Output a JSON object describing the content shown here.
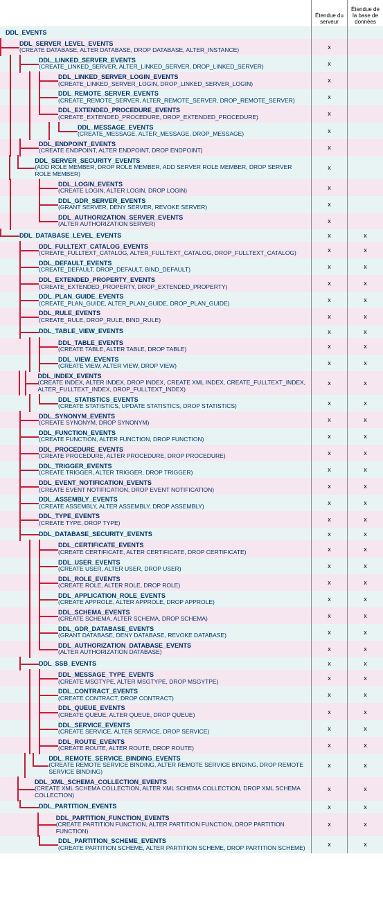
{
  "headers": {
    "col1": "Étendue du serveur",
    "col2": "Étendue de la base de données"
  },
  "tree": [
    {
      "depth": 0,
      "last": true,
      "name": "DDL_EVENTS",
      "desc": "",
      "s": "",
      "d": "",
      "bg": "even"
    },
    {
      "depth": 1,
      "last": false,
      "name": "DDL_SERVER_LEVEL_EVENTS",
      "desc": "(CREATE DATABASE, ALTER DATABASE, DROP DATABASE, ALTER_INSTANCE)",
      "s": "x",
      "d": "",
      "bg": "odd",
      "contLines": [
        true
      ]
    },
    {
      "depth": 2,
      "last": false,
      "name": "DDL_LINKED_SERVER_EVENTS",
      "desc": "(CREATE_LINKED_SERVER, ALTER_LINKED_SERVER, DROP_LINKED_SERVER)",
      "s": "x",
      "d": "",
      "bg": "even",
      "contLines": [
        true,
        true
      ]
    },
    {
      "depth": 3,
      "last": false,
      "name": "DDL_LINKED_SERVER_LOGIN_EVENTS",
      "desc": "(CREATE_LINKED_SERVER_LOGIN, DROP_LINKED_SERVER_LOGIN)",
      "s": "x",
      "d": "",
      "bg": "odd",
      "contLines": [
        true,
        true,
        true
      ]
    },
    {
      "depth": 3,
      "last": false,
      "name": "DDL_REMOTE_SERVER_EVENTS",
      "desc": "(CREATE_REMOTE_SERVER, ALTER_REMOTE_SERVER, DROP_REMOTE_SERVER)",
      "s": "x",
      "d": "",
      "bg": "even",
      "contLines": [
        true,
        true,
        true
      ]
    },
    {
      "depth": 3,
      "last": true,
      "name": "DDL_EXTENDED_PROCEDURE_EVENTS",
      "desc": "(CREATE_EXTENDED_PROCEDURE, DROP_EXTENDED_PROCEDURE)",
      "s": "x",
      "d": "",
      "bg": "odd",
      "contLines": [
        true,
        true,
        true
      ]
    },
    {
      "depth": 4,
      "last": true,
      "name": "DDL_MESSAGE_EVENTS",
      "desc": "(CREATE_MESSAGE, ALTER_MESSAGE, DROP_MESSAGE)",
      "s": "x",
      "d": "",
      "bg": "even",
      "contLines": [
        true,
        true,
        true,
        false
      ]
    },
    {
      "depth": 2,
      "last": false,
      "name": "DDL_ENDPOINT_EVENTS",
      "desc": "(CREATE ENDPOINT, ALTER ENDPOINT, DROP ENDPOINT)",
      "s": "x",
      "d": "",
      "bg": "odd",
      "contLines": [
        true,
        true
      ]
    },
    {
      "depth": 2,
      "last": true,
      "name": "DDL_SERVER_SECURITY_EVENTS",
      "desc": " (ADD ROLE MEMBER, DROP ROLE MEMBER, ADD SERVER ROLE MEMBER, DROP SERVER ROLE MEMBER)",
      "s": "x",
      "d": "",
      "bg": "even",
      "contLines": [
        true,
        true
      ]
    },
    {
      "depth": 3,
      "last": false,
      "name": "DDL_LOGIN_EVENTS",
      "desc": "(CREATE LOGIN, ALTER LOGIN, DROP LOGIN)",
      "s": "x",
      "d": "",
      "bg": "odd",
      "contLines": [
        true,
        false,
        true
      ]
    },
    {
      "depth": 3,
      "last": false,
      "name": "DDL_GDR_SERVER_EVENTS",
      "desc": "(GRANT SERVER, DENY SERVER, REVOKE SERVER)",
      "s": "x",
      "d": "",
      "bg": "even",
      "contLines": [
        true,
        false,
        true
      ]
    },
    {
      "depth": 3,
      "last": true,
      "name": "DDL_AUTHORIZATION_SERVER_EVENTS",
      "desc": "(ALTER AUTHORIZATION SERVER)",
      "s": "x",
      "d": "",
      "bg": "odd",
      "contLines": [
        true,
        false,
        true
      ]
    },
    {
      "depth": 1,
      "last": true,
      "name": "DDL_DATABASE_LEVEL_EVENTS",
      "desc": "",
      "s": "x",
      "d": "x",
      "bg": "even",
      "contLines": [
        true
      ]
    },
    {
      "depth": 2,
      "last": false,
      "name": "DDL_FULLTEXT_CATALOG_EVENTS",
      "desc": "(CREATE_FULLTEXT_CATALOG, ALTER_FULLTEXT_CATALOG, DROP_FULLTEXT_CATALOG)",
      "s": "x",
      "d": "x",
      "bg": "odd",
      "contLines": [
        false,
        true
      ]
    },
    {
      "depth": 2,
      "last": false,
      "name": "DDL_DEFAULT_EVENTS",
      "desc": "(CREATE_DEFAULT, DROP_DEFAULT, BIND_DEFAULT)",
      "s": "x",
      "d": "x",
      "bg": "even",
      "contLines": [
        false,
        true
      ]
    },
    {
      "depth": 2,
      "last": false,
      "name": "DDL_EXTENDED_PROPERTY_EVENTS",
      "desc": "(CREATE_EXTENDED_PROPERTY, DROP_EXTENDED_PROPERTY)",
      "s": "x",
      "d": "x",
      "bg": "odd",
      "contLines": [
        false,
        true
      ]
    },
    {
      "depth": 2,
      "last": false,
      "name": "DDL_PLAN_GUIDE_EVENTS",
      "desc": "(CREATE_PLAN_GUIDE, ALTER_PLAN_GUIDE, DROP_PLAN_GUIDE)",
      "s": "x",
      "d": "x",
      "bg": "even",
      "contLines": [
        false,
        true
      ]
    },
    {
      "depth": 2,
      "last": false,
      "name": "DDL_RULE_EVENTS",
      "desc": "(CREATE_RULE, DROP_RULE, BIND_RULE)",
      "s": "x",
      "d": "x",
      "bg": "odd",
      "contLines": [
        false,
        true
      ]
    },
    {
      "depth": 2,
      "last": false,
      "name": "DDL_TABLE_VIEW_EVENTS",
      "desc": "",
      "s": "x",
      "d": "x",
      "bg": "even",
      "contLines": [
        false,
        true
      ]
    },
    {
      "depth": 3,
      "last": false,
      "name": "DDL_TABLE_EVENTS",
      "desc": "(CREATE TABLE, ALTER TABLE, DROP TABLE)",
      "s": "x",
      "d": "x",
      "bg": "odd",
      "contLines": [
        false,
        true,
        true
      ]
    },
    {
      "depth": 3,
      "last": false,
      "name": "DDL_VIEW_EVENTS",
      "desc": "(CREATE VIEW, ALTER VIEW, DROP VIEW)",
      "s": "x",
      "d": "x",
      "bg": "even",
      "contLines": [
        false,
        true,
        true
      ]
    },
    {
      "depth": 3,
      "last": false,
      "name": "DDL_INDEX_EVENTS",
      "desc": "(CREATE INDEX, ALTER INDEX, DROP INDEX, CREATE XML INDEX, CREATE_FULLTEXT_INDEX, ALTER_FULLTEXT_INDEX, DROP_FULLTEXT_INDEX)",
      "s": "x",
      "d": "x",
      "bg": "odd",
      "contLines": [
        false,
        true,
        true
      ]
    },
    {
      "depth": 3,
      "last": true,
      "name": "DDL_STATISTICS_EVENTS",
      "desc": "(CREATE STATISTICS, UPDATE STATISTICS, DROP STATISTICS)",
      "s": "x",
      "d": "x",
      "bg": "even",
      "contLines": [
        false,
        true,
        true
      ]
    },
    {
      "depth": 2,
      "last": false,
      "name": "DDL_SYNONYM_EVENTS",
      "desc": "(CREATE SYNONYM, DROP SYNONYM)",
      "s": "x",
      "d": "x",
      "bg": "odd",
      "contLines": [
        false,
        true
      ]
    },
    {
      "depth": 2,
      "last": false,
      "name": "DDL_FUNCTION_EVENTS",
      "desc": "(CREATE FUNCTION, ALTER FUNCTION, DROP FUNCTION)",
      "s": "x",
      "d": "x",
      "bg": "even",
      "contLines": [
        false,
        true
      ]
    },
    {
      "depth": 2,
      "last": false,
      "name": "DDL_PROCEDURE_EVENTS",
      "desc": "(CREATE PROCEDURE, ALTER PROCEDURE, DROP PROCEDURE)",
      "s": "x",
      "d": "x",
      "bg": "odd",
      "contLines": [
        false,
        true
      ]
    },
    {
      "depth": 2,
      "last": false,
      "name": "DDL_TRIGGER_EVENTS",
      "desc": "(CREATE TRIGGER, ALTER TRIGGER, DROP TRIGGER)",
      "s": "x",
      "d": "x",
      "bg": "even",
      "contLines": [
        false,
        true
      ]
    },
    {
      "depth": 2,
      "last": false,
      "name": "DDL_EVENT_NOTIFICATION_EVENTS",
      "desc": "(CREATE EVENT NOTIFICATION, DROP EVENT NOTIFICATION)",
      "s": "x",
      "d": "x",
      "bg": "odd",
      "contLines": [
        false,
        true
      ]
    },
    {
      "depth": 2,
      "last": false,
      "name": "DDL_ASSEMBLY_EVENTS",
      "desc": "(CREATE ASSEMBLY, ALTER ASSEMBLY, DROP ASSEMBLY)",
      "s": "x",
      "d": "x",
      "bg": "even",
      "contLines": [
        false,
        true
      ]
    },
    {
      "depth": 2,
      "last": false,
      "name": "DDL_TYPE_EVENTS",
      "desc": "(CREATE TYPE, DROP TYPE)",
      "s": "x",
      "d": "x",
      "bg": "odd",
      "contLines": [
        false,
        true
      ]
    },
    {
      "depth": 2,
      "last": false,
      "name": "DDL_DATABASE_SECURITY_EVENTS",
      "desc": "",
      "s": "x",
      "d": "x",
      "bg": "even",
      "contLines": [
        false,
        true
      ]
    },
    {
      "depth": 3,
      "last": false,
      "name": "DDL_CERTIFICATE_EVENTS",
      "desc": "(CREATE CERTIFICATE, ALTER CERTIFICATE, DROP CERTIFICATE)",
      "s": "x",
      "d": "x",
      "bg": "odd",
      "contLines": [
        false,
        true,
        true
      ]
    },
    {
      "depth": 3,
      "last": false,
      "name": "DDL_USER_EVENTS",
      "desc": "(CREATE USER, ALTER USER, DROP USER)",
      "s": "x",
      "d": "x",
      "bg": "even",
      "contLines": [
        false,
        true,
        true
      ]
    },
    {
      "depth": 3,
      "last": false,
      "name": "DDL_ROLE_EVENTS",
      "desc": "(CREATE ROLE, ALTER ROLE, DROP ROLE)",
      "s": "x",
      "d": "x",
      "bg": "odd",
      "contLines": [
        false,
        true,
        true
      ]
    },
    {
      "depth": 3,
      "last": false,
      "name": "DDL_APPLICATION_ROLE_EVENTS",
      "desc": "(CREATE APPROLE, ALTER APPROLE, DROP APPROLE)",
      "s": "x",
      "d": "x",
      "bg": "even",
      "contLines": [
        false,
        true,
        true
      ]
    },
    {
      "depth": 3,
      "last": false,
      "name": "DDL_SCHEMA_EVENTS",
      "desc": "(CREATE SCHEMA, ALTER SCHEMA, DROP SCHEMA)",
      "s": "x",
      "d": "x",
      "bg": "odd",
      "contLines": [
        false,
        true,
        true
      ]
    },
    {
      "depth": 3,
      "last": false,
      "name": "DDL_GDR_DATABASE_EVENTS",
      "desc": "(GRANT DATABASE, DENY DATABASE, REVOKE DATABASE)",
      "s": "x",
      "d": "x",
      "bg": "even",
      "contLines": [
        false,
        true,
        true
      ]
    },
    {
      "depth": 3,
      "last": true,
      "name": "DDL_AUTHORIZATION_DATABASE_EVENTS",
      "desc": "(ALTER AUTHORIZATION DATABASE)",
      "s": "x",
      "d": "x",
      "bg": "odd",
      "contLines": [
        false,
        true,
        true
      ]
    },
    {
      "depth": 2,
      "last": false,
      "name": "DDL_SSB_EVENTS",
      "desc": "",
      "s": "x",
      "d": "x",
      "bg": "even",
      "contLines": [
        false,
        true
      ]
    },
    {
      "depth": 3,
      "last": false,
      "name": "DDL_MESSAGE_TYPE_EVENTS",
      "desc": "(CREATE MSGTYPE, ALTER MSGTYPE, DROP MSGYTPE)",
      "s": "x",
      "d": "x",
      "bg": "odd",
      "contLines": [
        false,
        true,
        true
      ]
    },
    {
      "depth": 3,
      "last": false,
      "name": "DDL_CONTRACT_EVENTS",
      "desc": "(CREATE CONTRACT, DROP CONTRACT)",
      "s": "x",
      "d": "x",
      "bg": "even",
      "contLines": [
        false,
        true,
        true
      ]
    },
    {
      "depth": 3,
      "last": false,
      "name": "DDL_QUEUE_EVENTS",
      "desc": "(CREATE QUEUE, ALTER QUEUE, DROP QUEUE)",
      "s": "x",
      "d": "x",
      "bg": "odd",
      "contLines": [
        false,
        true,
        true
      ]
    },
    {
      "depth": 3,
      "last": false,
      "name": "DDL_SERVICE_EVENTS",
      "desc": "(CREATE SERVICE, ALTER SERVICE, DROP SERVICE)",
      "s": "x",
      "d": "x",
      "bg": "even",
      "contLines": [
        false,
        true,
        true
      ]
    },
    {
      "depth": 3,
      "last": false,
      "name": "DDL_ROUTE_EVENTS",
      "desc": "(CREATE ROUTE, ALTER ROUTE, DROP ROUTE)",
      "s": "x",
      "d": "x",
      "bg": "odd",
      "contLines": [
        false,
        true,
        true
      ]
    },
    {
      "depth": 3,
      "last": true,
      "name": "DDL_REMOTE_SERVICE_BINDING_EVENTS",
      "desc": "(CREATE REMOTE SERVICE BINDING, ALTER REMOTE SERVICE BINDING, DROP REMOTE SERVICE BINDING)",
      "s": "x",
      "d": "x",
      "bg": "even",
      "contLines": [
        false,
        true,
        true
      ]
    },
    {
      "depth": 2,
      "last": false,
      "name": "DDL_XML_SCHEMA_COLLECTION_EVENTS",
      "desc": "(CREATE XML SCHEMA COLLECTION, ALTER XML SCHEMA COLLECTION, DROP XML SCHEMA COLLECTION)",
      "s": "x",
      "d": "x",
      "bg": "odd",
      "contLines": [
        false,
        true
      ]
    },
    {
      "depth": 2,
      "last": true,
      "name": "DDL_PARTITION_EVENTS",
      "desc": "",
      "s": "x",
      "d": "x",
      "bg": "even",
      "contLines": [
        false,
        true
      ]
    },
    {
      "depth": 3,
      "last": false,
      "name": "DDL_PARTITION_FUNCTION_EVENTS",
      "desc": "(CREATE PARTITION FUNCTION, ALTER PARTITION FUNCTION, DROP PARTITION FUNCTION)",
      "s": "x",
      "d": "x",
      "bg": "odd",
      "contLines": [
        false,
        false,
        true
      ]
    },
    {
      "depth": 3,
      "last": true,
      "name": "DDL_PARTITION_SCHEME_EVENTS",
      "desc": "(CREATE PARTITION SCHEME, ALTER PARTITION SCHEME, DROP PARTITION SCHEME)",
      "s": "x",
      "d": "x",
      "bg": "even",
      "contLines": [
        false,
        false,
        true
      ]
    }
  ]
}
